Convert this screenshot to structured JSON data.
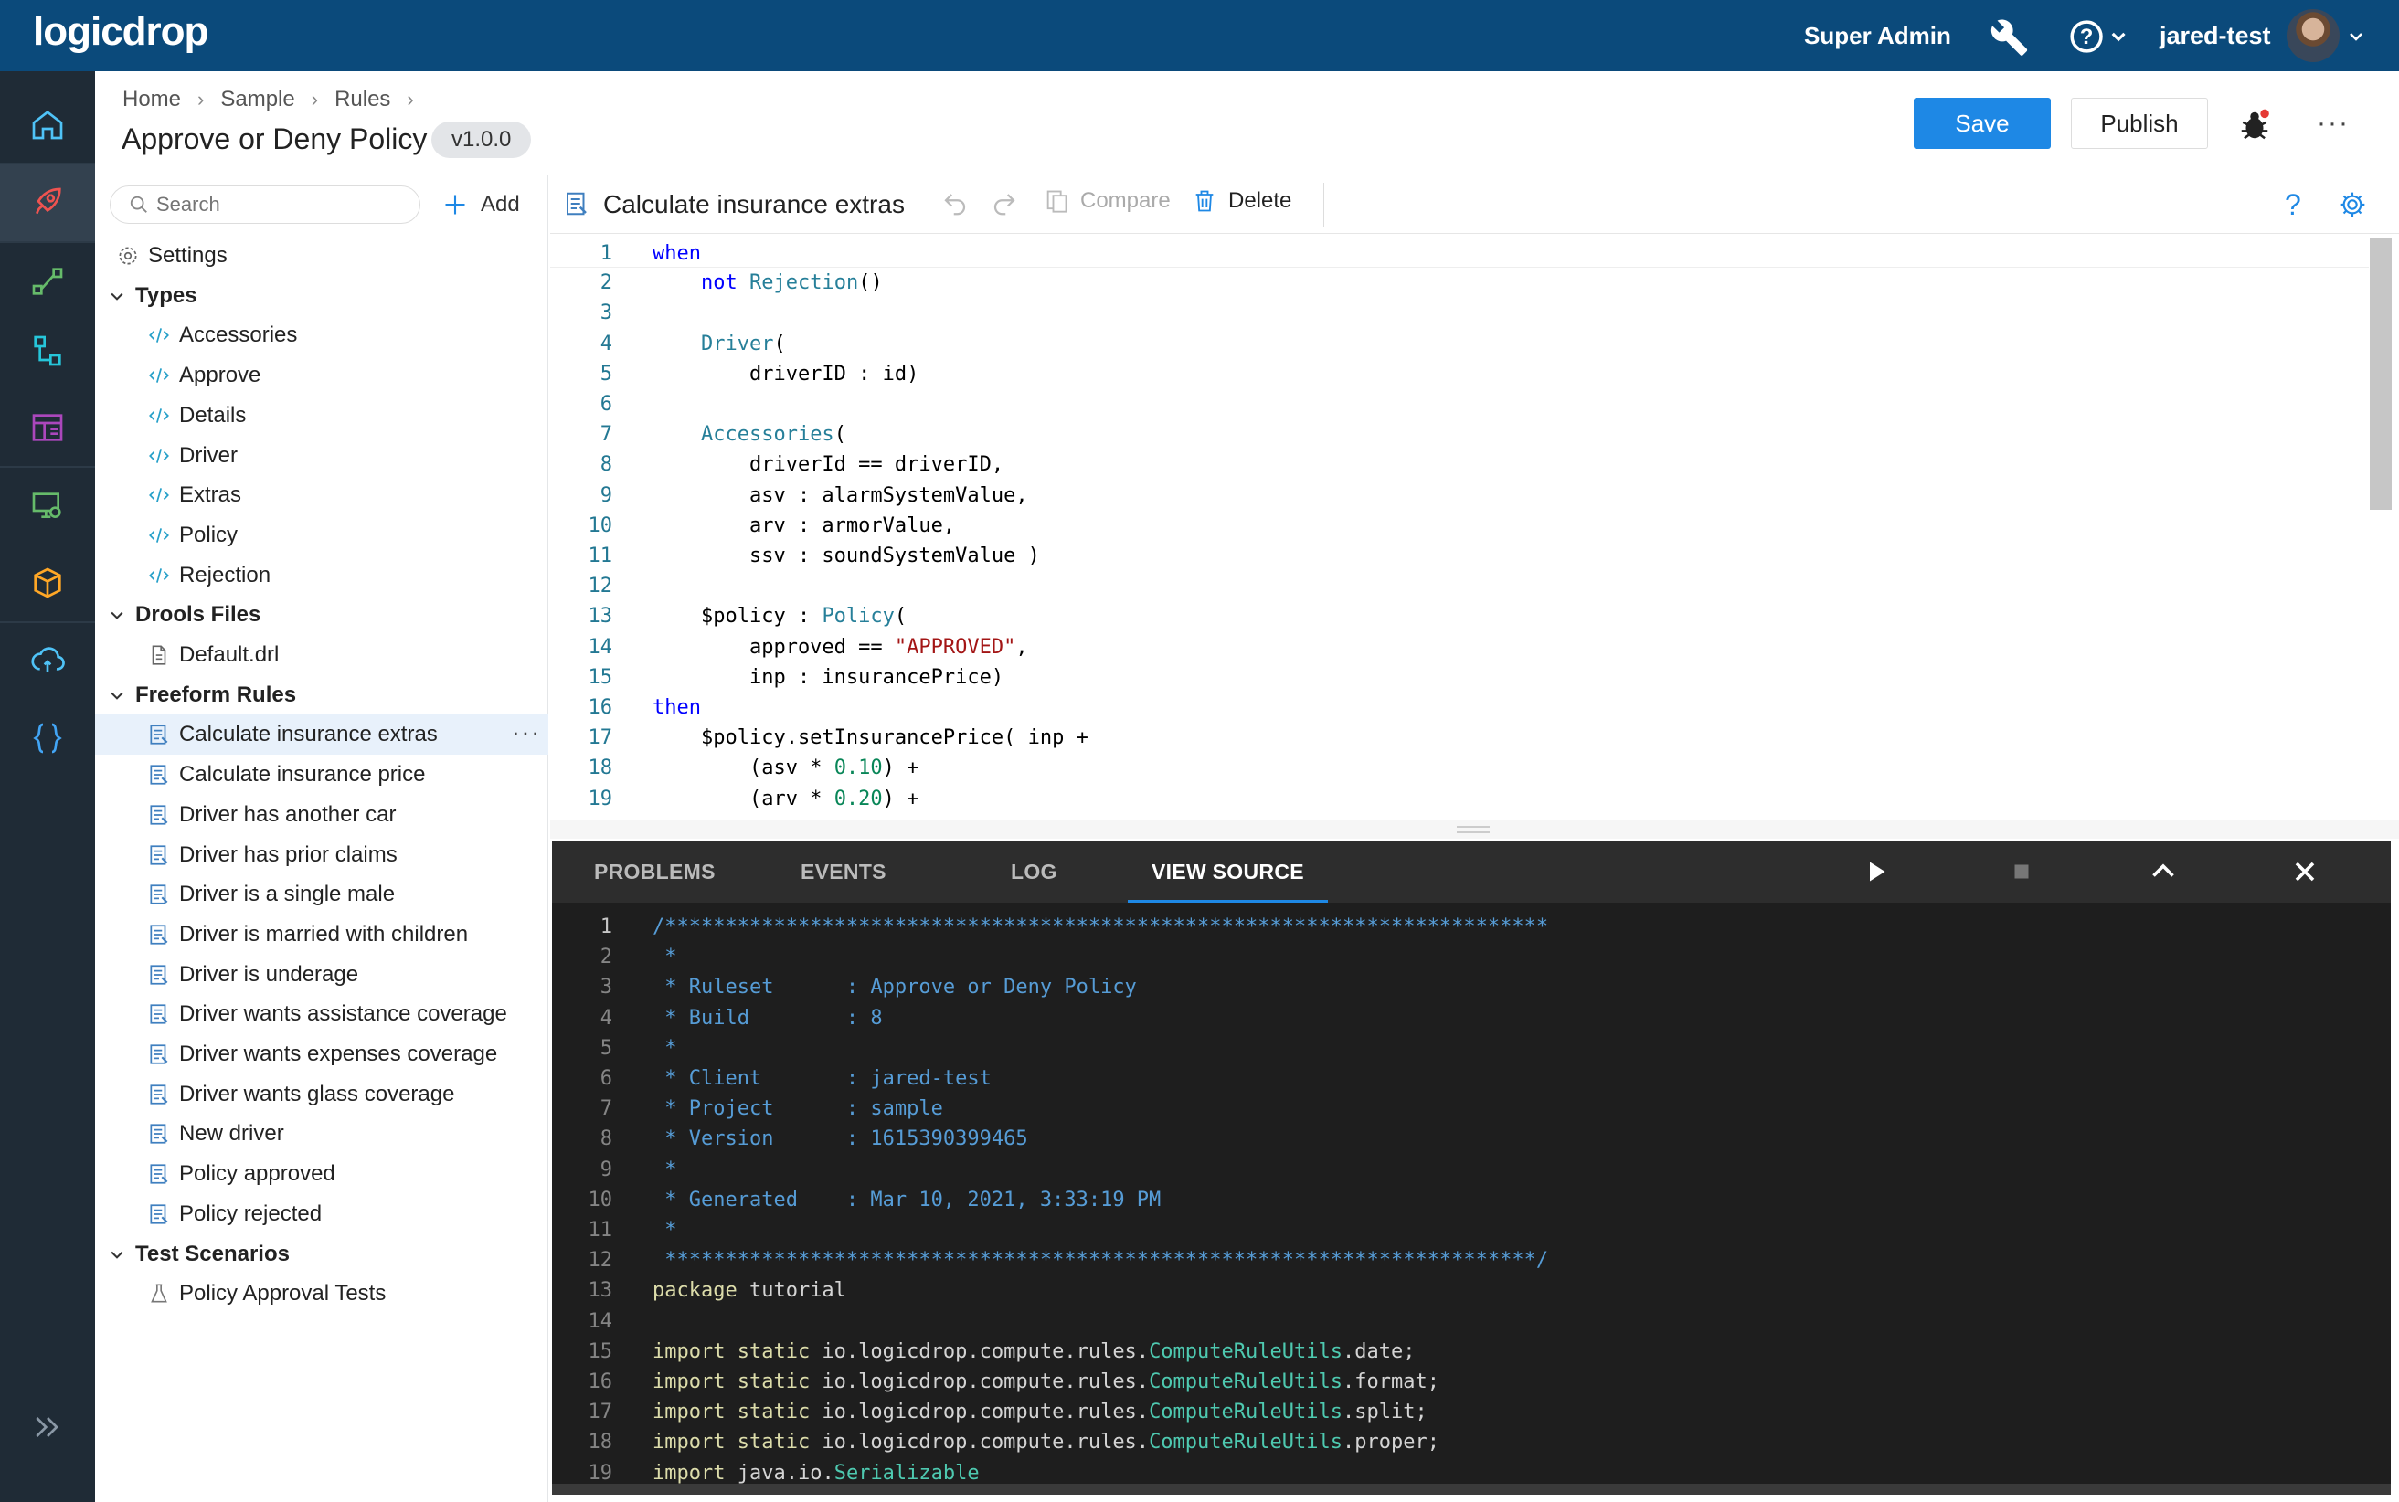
{
  "app": {
    "logo": "logicdrop",
    "role": "Super Admin",
    "user": "jared-test"
  },
  "breadcrumb": [
    "Home",
    "Sample",
    "Rules"
  ],
  "header": {
    "title": "Approve or Deny Policy",
    "version": "v1.0.0",
    "save_label": "Save",
    "publish_label": "Publish"
  },
  "sidebar": {
    "search_placeholder": "Search",
    "add_label": "Add",
    "settings_label": "Settings",
    "groups": [
      {
        "label": "Types",
        "items": [
          "Accessories",
          "Approve",
          "Details",
          "Driver",
          "Extras",
          "Policy",
          "Rejection"
        ]
      },
      {
        "label": "Drools Files",
        "items": [
          "Default.drl"
        ]
      },
      {
        "label": "Freeform Rules",
        "items": [
          "Calculate insurance extras",
          "Calculate insurance price",
          "Driver has another car",
          "Driver has prior claims",
          "Driver is a single male",
          "Driver is married with children",
          "Driver is underage",
          "Driver wants assistance coverage",
          "Driver wants expenses coverage",
          "Driver wants glass coverage",
          "New driver",
          "Policy approved",
          "Policy rejected"
        ]
      },
      {
        "label": "Test Scenarios",
        "items": [
          "Policy Approval Tests"
        ]
      }
    ],
    "selected_item": "Calculate insurance extras"
  },
  "editor": {
    "title": "Calculate insurance extras",
    "compare_label": "Compare",
    "delete_label": "Delete",
    "lines": [
      "when",
      "    not Rejection()",
      "",
      "    Driver(",
      "        driverID : id)",
      "",
      "    Accessories(",
      "        driverId == driverID,",
      "        asv : alarmSystemValue,",
      "        arv : armorValue,",
      "        ssv : soundSystemValue )",
      "",
      "    $policy : Policy(",
      "        approved == \"APPROVED\",",
      "        inp : insurancePrice)",
      "then",
      "    $policy.setInsurancePrice( inp +",
      "        (asv * 0.10) +",
      "        (arv * 0.20) +"
    ]
  },
  "panel": {
    "tabs": [
      "PROBLEMS",
      "EVENTS",
      "LOG",
      "VIEW SOURCE"
    ],
    "active_tab": "VIEW SOURCE",
    "lines": [
      "/*************************************************************************",
      " *",
      " * Ruleset      : Approve or Deny Policy",
      " * Build        : 8",
      " *",
      " * Client       : jared-test",
      " * Project      : sample",
      " * Version      : 1615390399465",
      " *",
      " * Generated    : Mar 10, 2021, 3:33:19 PM",
      " *",
      " ************************************************************************/",
      "package tutorial",
      "",
      "import static io.logicdrop.compute.rules.ComputeRuleUtils.date;",
      "import static io.logicdrop.compute.rules.ComputeRuleUtils.format;",
      "import static io.logicdrop.compute.rules.ComputeRuleUtils.split;",
      "import static io.logicdrop.compute.rules.ComputeRuleUtils.proper;",
      "import java.io.Serializable"
    ]
  },
  "colors": {
    "topbar": "#0b4a7b",
    "rail": "#1f2b36",
    "accent": "#1e88e5"
  }
}
